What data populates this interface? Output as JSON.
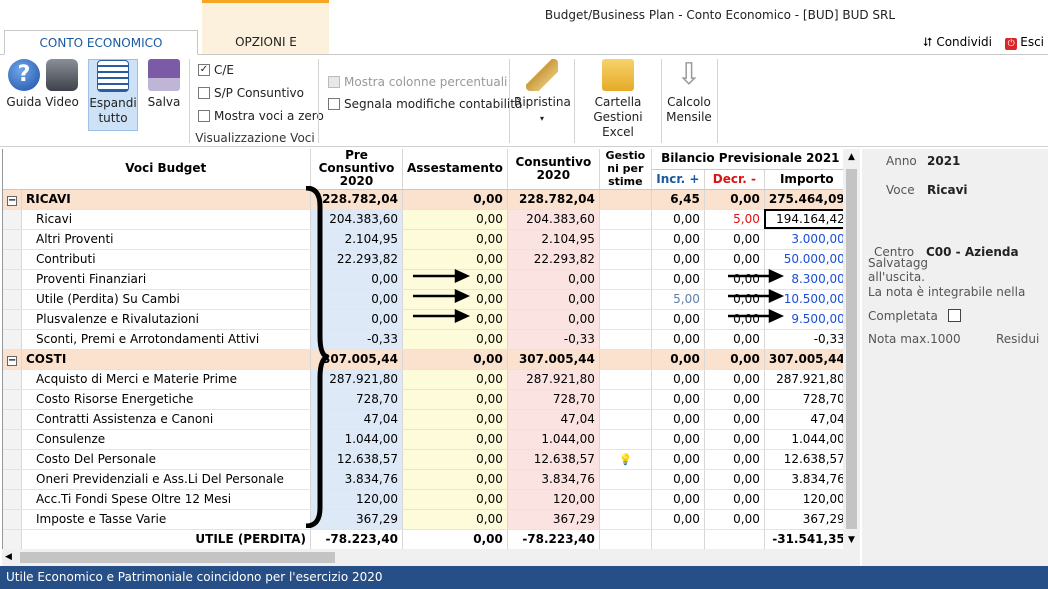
{
  "window": {
    "title": "Budget/Business Plan - Conto Economico - [BUD] BUD SRL"
  },
  "tabs": [
    {
      "label": "CONTO ECONOMICO ANNUALE"
    },
    {
      "label": "OPZIONI E STAMPA"
    }
  ],
  "top_actions": {
    "share": "Condividi",
    "exit": "Esci"
  },
  "ribbon": {
    "guida": "Guida",
    "video": "Video",
    "espandi": "Espandi tutto",
    "salva": "Salva",
    "ce": "C/E",
    "sp": "S/P Consuntivo",
    "mostra_zero": "Mostra voci a zero",
    "group_label": "Visualizzazione Voci",
    "mostra_perc": "Mostra colonne percentuali",
    "segnala": "Segnala modifiche contabilità",
    "ripristina": "Ripristina",
    "cartella": "Cartella Gestioni Excel",
    "calcolo": "Calcolo Mensile"
  },
  "grid": {
    "headers": {
      "voci": "Voci Budget",
      "pre": "Pre Consuntivo 2020",
      "ass": "Assestamento",
      "con": "Consuntivo 2020",
      "gest": "Gestio ni per stime",
      "bp": "Bilancio Previsionale 2021",
      "inc": "Incr. +",
      "dec": "Decr. -",
      "imp": "Importo"
    },
    "rows": [
      {
        "type": "cat",
        "name": "RICAVI",
        "pre": "228.782,04",
        "ass": "0,00",
        "con": "228.782,04",
        "inc": "6,45",
        "dec": "0,00",
        "imp": "275.464,09"
      },
      {
        "type": "item",
        "name": "Ricavi",
        "pre": "204.383,60",
        "ass": "0,00",
        "con": "204.383,60",
        "inc": "0,00",
        "dec": "5,00",
        "imp": "194.164,42"
      },
      {
        "type": "item",
        "name": "Altri Proventi",
        "pre": "2.104,95",
        "ass": "0,00",
        "con": "2.104,95",
        "inc": "0,00",
        "dec": "0,00",
        "imp": "3.000,00"
      },
      {
        "type": "item",
        "name": "Contributi",
        "pre": "22.293,82",
        "ass": "0,00",
        "con": "22.293,82",
        "inc": "0,00",
        "dec": "0,00",
        "imp": "50.000,00"
      },
      {
        "type": "item",
        "name": "Proventi Finanziari",
        "pre": "0,00",
        "ass": "0,00",
        "con": "0,00",
        "inc": "0,00",
        "dec": "0,00",
        "imp": "8.300,00"
      },
      {
        "type": "item",
        "name": "Utile (Perdita) Su Cambi",
        "pre": "0,00",
        "ass": "0,00",
        "con": "0,00",
        "inc": "5,00",
        "dec": "0,00",
        "imp": "10.500,00"
      },
      {
        "type": "item",
        "name": "Plusvalenze e Rivalutazioni",
        "pre": "0,00",
        "ass": "0,00",
        "con": "0,00",
        "inc": "0,00",
        "dec": "0,00",
        "imp": "9.500,00"
      },
      {
        "type": "item",
        "name": "Sconti, Premi e Arrotondamenti  Attivi",
        "pre": "-0,33",
        "ass": "0,00",
        "con": "-0,33",
        "inc": "0,00",
        "dec": "0,00",
        "imp": "-0,33"
      },
      {
        "type": "cat",
        "name": "COSTI",
        "pre": "307.005,44",
        "ass": "0,00",
        "con": "307.005,44",
        "inc": "0,00",
        "dec": "0,00",
        "imp": "307.005,44"
      },
      {
        "type": "item",
        "name": "Acquisto di Merci e Materie Prime",
        "pre": "287.921,80",
        "ass": "0,00",
        "con": "287.921,80",
        "inc": "0,00",
        "dec": "0,00",
        "imp": "287.921,80"
      },
      {
        "type": "item",
        "name": "Costo Risorse Energetiche",
        "pre": "728,70",
        "ass": "0,00",
        "con": "728,70",
        "inc": "0,00",
        "dec": "0,00",
        "imp": "728,70"
      },
      {
        "type": "item",
        "name": "Contratti Assistenza e Canoni",
        "pre": "47,04",
        "ass": "0,00",
        "con": "47,04",
        "inc": "0,00",
        "dec": "0,00",
        "imp": "47,04"
      },
      {
        "type": "item",
        "name": "Consulenze",
        "pre": "1.044,00",
        "ass": "0,00",
        "con": "1.044,00",
        "inc": "0,00",
        "dec": "0,00",
        "imp": "1.044,00"
      },
      {
        "type": "item",
        "name": "Costo Del Personale",
        "pre": "12.638,57",
        "ass": "0,00",
        "con": "12.638,57",
        "inc": "0,00",
        "dec": "0,00",
        "imp": "12.638,57"
      },
      {
        "type": "item",
        "name": "Oneri Previdenziali e Ass.Li Del Personale",
        "pre": "3.834,76",
        "ass": "0,00",
        "con": "3.834,76",
        "inc": "0,00",
        "dec": "0,00",
        "imp": "3.834,76"
      },
      {
        "type": "item",
        "name": "Acc.Ti Fondi Spese Oltre 12 Mesi",
        "pre": "120,00",
        "ass": "0,00",
        "con": "120,00",
        "inc": "0,00",
        "dec": "0,00",
        "imp": "120,00"
      },
      {
        "type": "item",
        "name": "Imposte e Tasse Varie",
        "pre": "367,29",
        "ass": "0,00",
        "con": "367,29",
        "inc": "0,00",
        "dec": "0,00",
        "imp": "367,29"
      },
      {
        "type": "total",
        "name": "UTILE (PERDITA)",
        "pre": "-78.223,40",
        "ass": "0,00",
        "con": "-78.223,40",
        "inc": "",
        "dec": "",
        "imp": "-31.541,35"
      }
    ]
  },
  "side": {
    "anno_label": "Anno",
    "anno_val": "2021",
    "voce_label": "Voce",
    "voce_val": "Ricavi",
    "centro_label": "Centro",
    "centro_val": "C00 - Azienda",
    "note1": "Salvatagg",
    "note2": "all'uscita.",
    "note3": "La nota è integrabile nella",
    "completata": "Completata",
    "nota_max": "Nota max.1000",
    "residui": "Residui"
  },
  "status": {
    "text": "Utile Economico e Patrimoniale coincidono per l'esercizio 2020"
  }
}
